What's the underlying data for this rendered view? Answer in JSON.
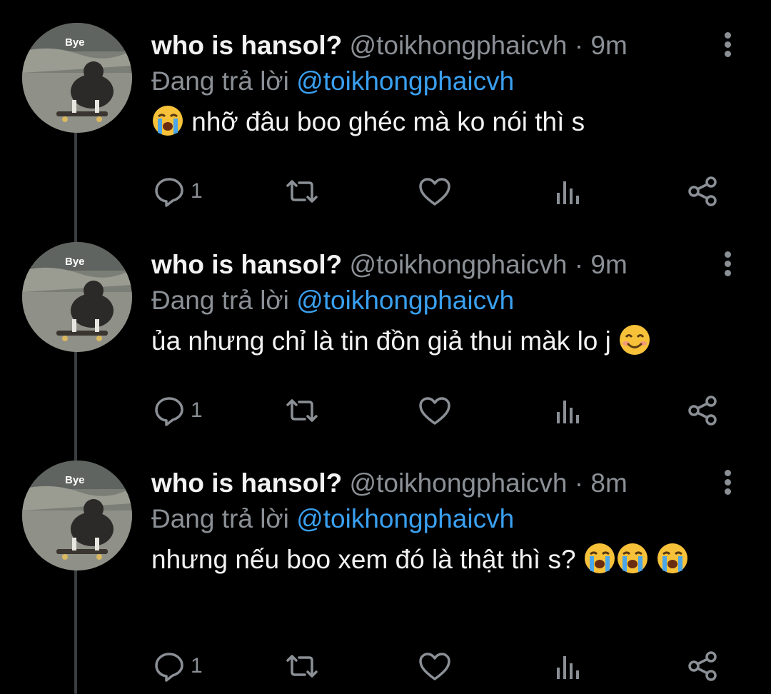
{
  "tweets": [
    {
      "author": "who is hansol?",
      "handle": "@toikhongphaicvh",
      "separator": "·",
      "time": "9m",
      "reply_prefix": "Đang trả lời",
      "reply_to": "@toikhongphaicvh",
      "text": "nhỡ đâu boo ghéc mà ko nói thì s",
      "emoji_before": [
        "loudly-crying-face"
      ],
      "emoji_after": [],
      "reply_count": "1",
      "avatar_label": "Bye"
    },
    {
      "author": "who is hansol?",
      "handle": "@toikhongphaicvh",
      "separator": "·",
      "time": "9m",
      "reply_prefix": "Đang trả lời",
      "reply_to": "@toikhongphaicvh",
      "text": "ủa nhưng chỉ là tin đồn giả thui màk lo j",
      "emoji_before": [],
      "emoji_after": [
        "smiling-face"
      ],
      "reply_count": "1",
      "avatar_label": "Bye"
    },
    {
      "author": "who is hansol?",
      "handle": "@toikhongphaicvh",
      "separator": "·",
      "time": "8m",
      "reply_prefix": "Đang trả lời",
      "reply_to": "@toikhongphaicvh",
      "text": "nhưng nếu boo xem đó là thật thì s?",
      "emoji_before": [],
      "emoji_after": [
        "loudly-crying-face",
        "loudly-crying-face",
        "loudly-crying-face"
      ],
      "reply_count": "1",
      "avatar_label": "Bye"
    }
  ],
  "icons": {
    "reply": "speech-bubble-icon",
    "retweet": "retweet-icon",
    "like": "heart-icon",
    "analytics": "bar-chart-icon",
    "share": "share-icon",
    "more": "vertical-dots-icon"
  },
  "colors": {
    "background": "#000000",
    "text": "#f2f2f2",
    "muted": "#8b9096",
    "link": "#3aa0f0",
    "thread_line": "#3a3d40"
  }
}
